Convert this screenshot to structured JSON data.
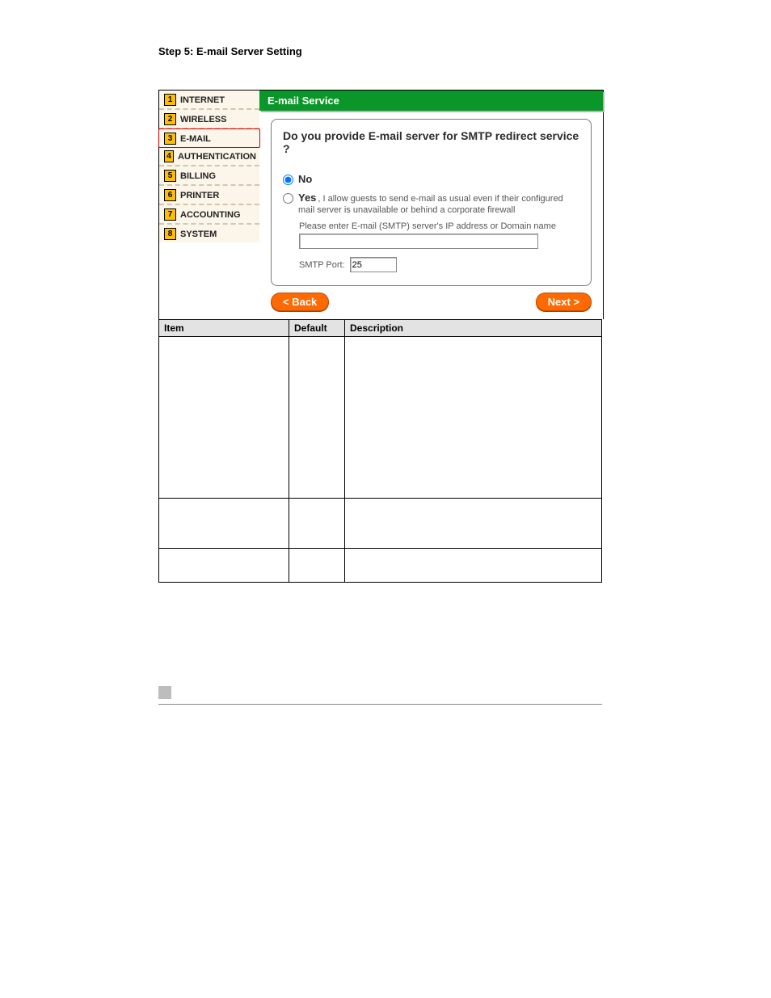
{
  "step_title": "Step 5: E-mail Server Setting",
  "nav": {
    "items": [
      {
        "num": "1",
        "label": "INTERNET"
      },
      {
        "num": "2",
        "label": "WIRELESS"
      },
      {
        "num": "3",
        "label": "E-MAIL"
      },
      {
        "num": "4",
        "label": "AUTHENTICATION"
      },
      {
        "num": "5",
        "label": "BILLING"
      },
      {
        "num": "6",
        "label": "PRINTER"
      },
      {
        "num": "7",
        "label": "ACCOUNTING"
      },
      {
        "num": "8",
        "label": "SYSTEM"
      }
    ],
    "selected_index": 2
  },
  "panel": {
    "heading": "E-mail Service",
    "question": "Do you provide E-mail server for SMTP redirect service ?",
    "option_no": "No",
    "option_yes": "Yes",
    "option_yes_desc": ", I allow guests to send e-mail as usual even if their configured mail server is unavailable or behind a corporate firewall",
    "ip_hint": "Please enter E-mail (SMTP) server's IP address or Domain name",
    "ip_value": "",
    "port_label": "SMTP Port:",
    "port_value": "25"
  },
  "buttons": {
    "back": "< Back",
    "next": "Next >"
  },
  "table": {
    "headers": {
      "item": "Item",
      "default": "Default",
      "description": "Description"
    },
    "rows": [
      {
        "item": "",
        "default": "",
        "description": ""
      },
      {
        "item": "",
        "default": "",
        "description": ""
      },
      {
        "item": "",
        "default": "",
        "description": ""
      }
    ]
  }
}
